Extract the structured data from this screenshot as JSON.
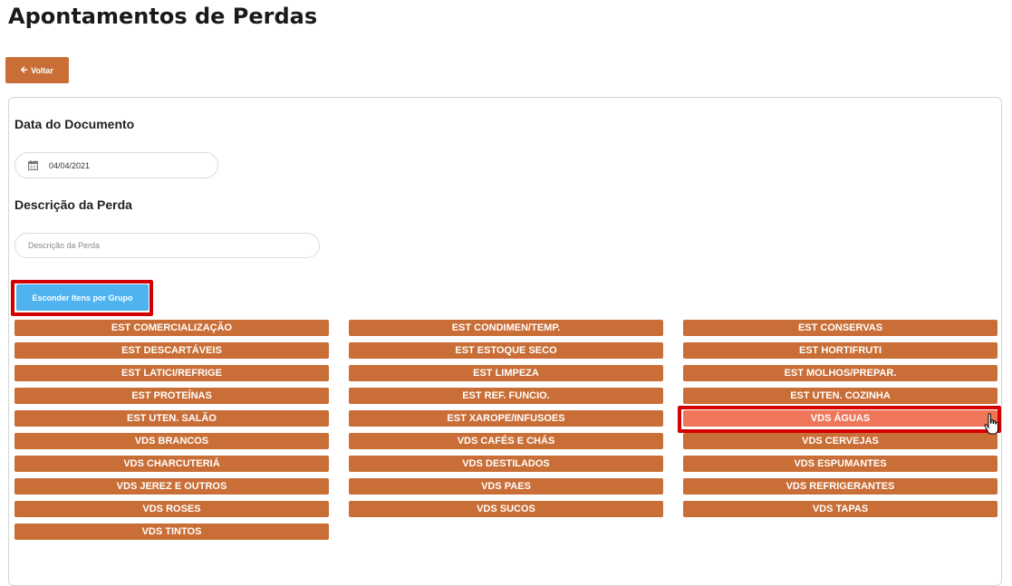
{
  "page": {
    "title": "Apontamentos de Perdas"
  },
  "back_button": {
    "label": "Voltar",
    "icon": "arrow-left-icon"
  },
  "form": {
    "date_label": "Data do Documento",
    "date_value": "04/04/2021",
    "date_icon": "calendar-icon",
    "description_label": "Descrição da Perda",
    "description_placeholder": "Descrição da Perda",
    "description_value": ""
  },
  "toggle_button": {
    "label": "Esconder Itens por Grupo",
    "highlighted": true
  },
  "groups": [
    {
      "label": "EST COMERCIALIZAÇÃO"
    },
    {
      "label": "EST CONDIMEN/TEMP."
    },
    {
      "label": "EST CONSERVAS"
    },
    {
      "label": "EST DESCARTÁVEIS"
    },
    {
      "label": "EST ESTOQUE SECO"
    },
    {
      "label": "EST HORTIFRUTI"
    },
    {
      "label": "EST LATICI/REFRIGE"
    },
    {
      "label": "EST LIMPEZA"
    },
    {
      "label": "EST MOLHOS/PREPAR."
    },
    {
      "label": "EST PROTEÍNAS"
    },
    {
      "label": "EST REF. FUNCIO."
    },
    {
      "label": "EST UTEN. COZINHA"
    },
    {
      "label": "EST UTEN. SALÃO"
    },
    {
      "label": "EST XAROPE/INFUSOES"
    },
    {
      "label": "VDS ÁGUAS",
      "active": true
    },
    {
      "label": "VDS BRANCOS"
    },
    {
      "label": "VDS CAFÉS E CHÁS"
    },
    {
      "label": "VDS CERVEJAS"
    },
    {
      "label": "VDS CHARCUTERIÁ"
    },
    {
      "label": "VDS DESTILADOS"
    },
    {
      "label": "VDS ESPUMANTES"
    },
    {
      "label": "VDS JEREZ E OUTROS"
    },
    {
      "label": "VDS PAES"
    },
    {
      "label": "VDS REFRIGERANTES"
    },
    {
      "label": "VDS ROSES"
    },
    {
      "label": "VDS SUCOS"
    },
    {
      "label": "VDS TAPAS"
    },
    {
      "label": "VDS TINTOS"
    }
  ],
  "colors": {
    "primary": "#c96e36",
    "active": "#f0765a",
    "toggle": "#4fb3f0",
    "highlight": "#d40000"
  }
}
